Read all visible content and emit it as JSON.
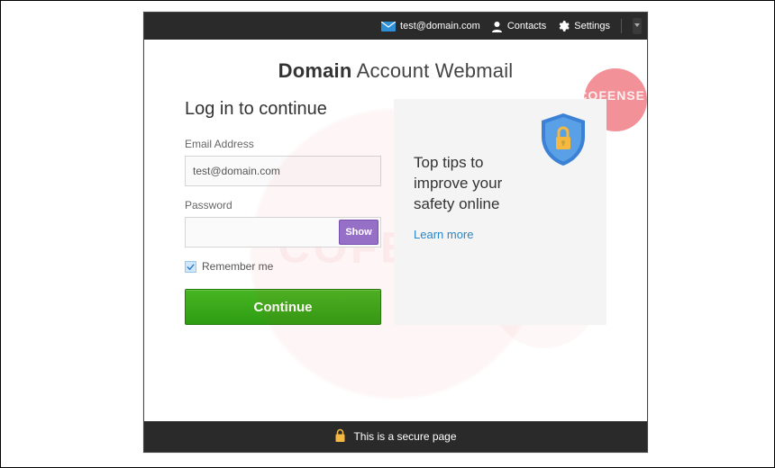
{
  "topbar": {
    "email": "test@domain.com",
    "contacts": "Contacts",
    "settings": "Settings"
  },
  "watermark": {
    "small": "COFENSE",
    "big": "COFENSE"
  },
  "header": {
    "title_bold": "Domain",
    "title_rest": "Account Webmail"
  },
  "login": {
    "heading": "Log in to continue",
    "email_label": "Email Address",
    "email_value": "test@domain.com",
    "password_label": "Password",
    "password_value": "",
    "show_label": "Show",
    "remember_label": "Remember me",
    "continue_label": "Continue"
  },
  "tips": {
    "title": "Top tips to improve your safety online",
    "learn_more": "Learn more"
  },
  "footer": {
    "text": "This is a secure page"
  }
}
